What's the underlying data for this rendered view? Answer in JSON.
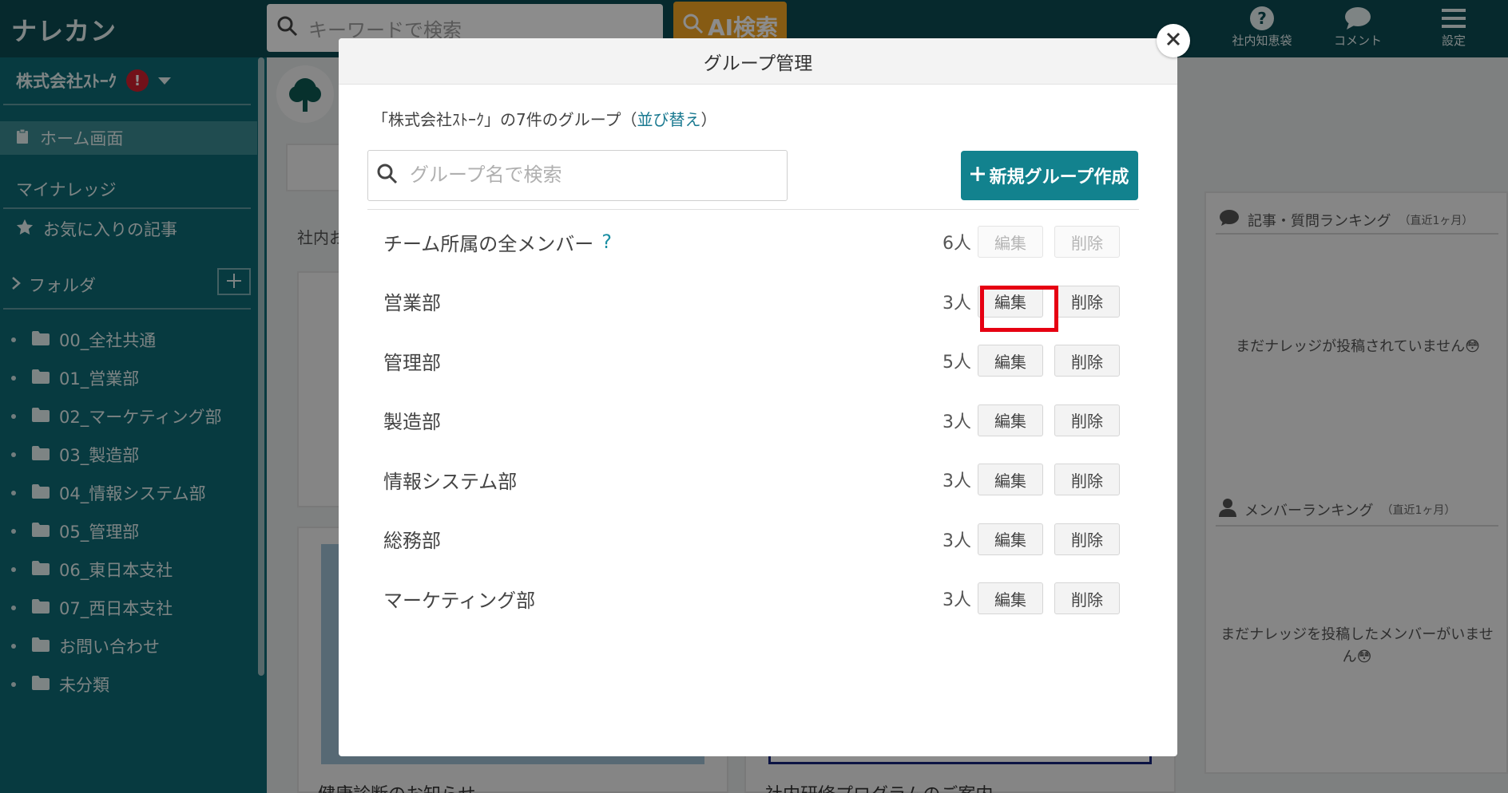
{
  "app": {
    "logo": "ナレカン"
  },
  "header": {
    "search_placeholder": "キーワードで検索",
    "ai_button": "AI検索",
    "icons": [
      {
        "icon": "help-icon",
        "label": "社内知恵袋"
      },
      {
        "icon": "comment-icon",
        "label": "コメント"
      },
      {
        "icon": "menu-icon",
        "label": "設定"
      }
    ]
  },
  "sidebar": {
    "company": "株式会社ｽﾄｰｸ",
    "badge": "!",
    "home": "ホーム画面",
    "my_knowledge": "マイナレッジ",
    "favorites": "お気に入りの記事",
    "folder_label": "フォルダ",
    "folders": [
      "00_全社共通",
      "01_営業部",
      "02_マーケティング部",
      "03_製造部",
      "04_情報システム部",
      "05_管理部",
      "06_東日本支社",
      "07_西日本支社",
      "お問い合わせ",
      "未分類"
    ]
  },
  "background": {
    "partial_label": "社内お",
    "article_1": "健康診断のお知らせ",
    "article_2": "社内研修プログラムのご案内",
    "ranking_title": "記事・質問ランキング",
    "ranking_period": "（直近1ヶ月）",
    "ranking_empty": "まだナレッジが投稿されていません😳",
    "member_title": "メンバーランキング",
    "member_period": "（直近1ヶ月）",
    "member_empty": "まだナレッジを投稿したメンバーがいません😳"
  },
  "modal": {
    "title": "グループ管理",
    "summary_prefix": "「株式会社ｽﾄｰｸ」の7件のグループ（",
    "summary_link": "並び替え",
    "summary_suffix": "）",
    "search_placeholder": "グループ名で検索",
    "new_button": "新規グループ作成",
    "edit_label": "編集",
    "delete_label": "削除",
    "groups": [
      {
        "name": "チーム所属の全メンバー",
        "count": "6人",
        "help": "?",
        "disabled": true
      },
      {
        "name": "営業部",
        "count": "3人"
      },
      {
        "name": "管理部",
        "count": "5人"
      },
      {
        "name": "製造部",
        "count": "3人"
      },
      {
        "name": "情報システム部",
        "count": "3人"
      },
      {
        "name": "総務部",
        "count": "3人"
      },
      {
        "name": "マーケティング部",
        "count": "3人"
      }
    ]
  },
  "colors": {
    "primary": "#12828e",
    "sidebar": "#0e6a75",
    "topbar": "#0c4b53",
    "highlight": "#e60012",
    "ai": "#f5a623"
  }
}
